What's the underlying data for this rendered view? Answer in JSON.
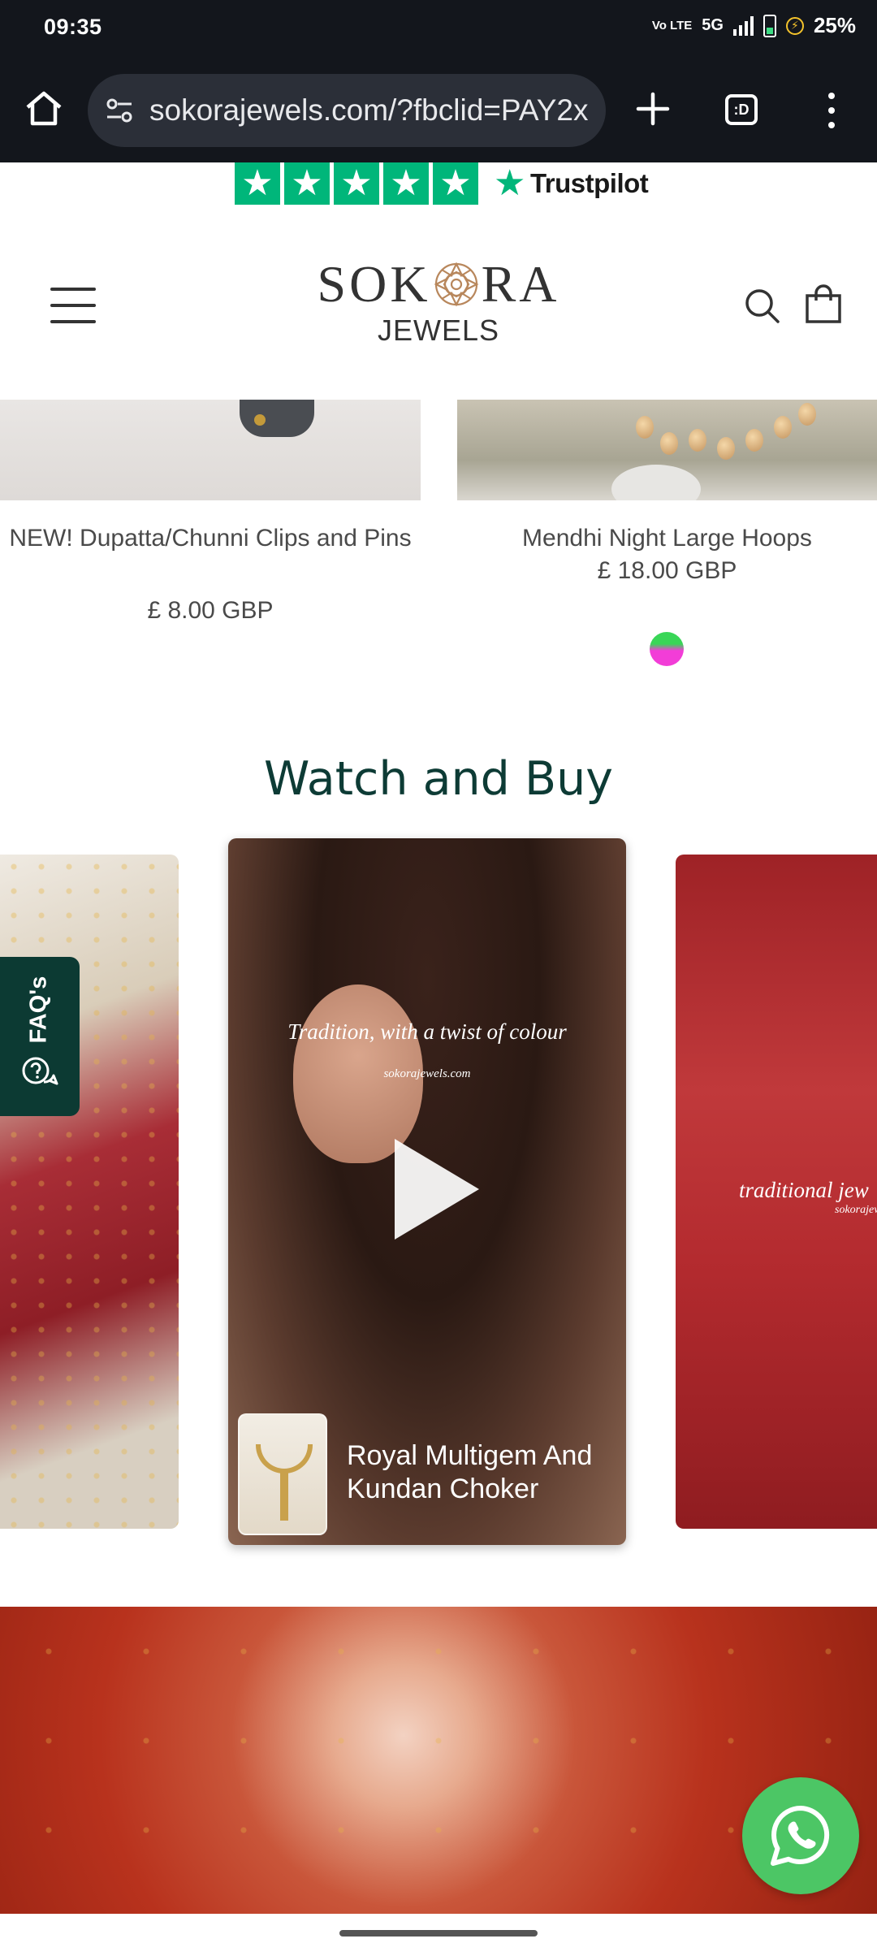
{
  "status_bar": {
    "time": "09:35",
    "volte": "Vo LTE",
    "network": "5G",
    "battery": "25%"
  },
  "browser": {
    "url": "sokorajewels.com/?fbclid=PAY2x"
  },
  "trustpilot": {
    "stars": 5,
    "brand": "Trustpilot",
    "color": "#00b67a"
  },
  "header": {
    "logo_line1_a": "SOK",
    "logo_line1_b": "RA",
    "logo_line2": "JEWELS"
  },
  "products": [
    {
      "title": "NEW! Dupatta/Chunni Clips and Pins",
      "price": "£ 8.00 GBP"
    },
    {
      "title": "Mendhi Night Large Hoops",
      "price": "£ 18.00 GBP"
    }
  ],
  "watch_and_buy": {
    "title": "Watch and Buy",
    "center_card": {
      "caption": "Tradition, with a twist of colour",
      "watermark": "sokorajewels.com",
      "product": "Royal Multigem And Kundan Choker"
    },
    "right_card": {
      "caption": "traditional jew",
      "watermark": "sokorajew"
    }
  },
  "faq_tab": {
    "label": "FAQ's"
  },
  "colors": {
    "brand_dark": "#0d3b35",
    "whatsapp": "#4cc665",
    "status_bar": "#13161c"
  }
}
